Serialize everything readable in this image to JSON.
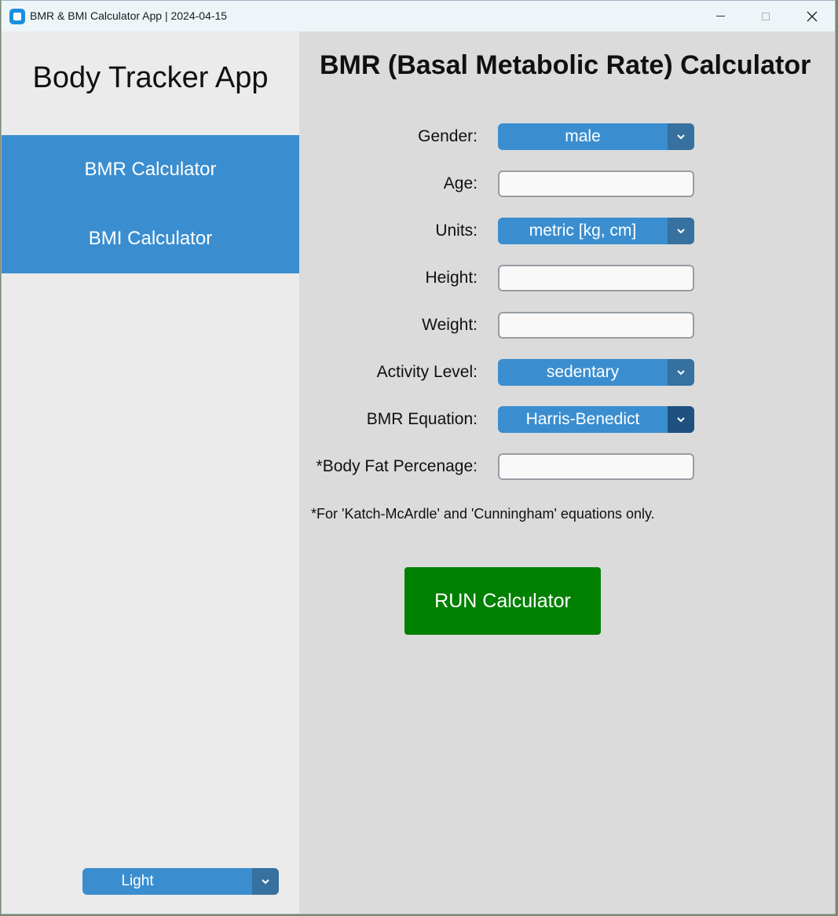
{
  "window": {
    "title": "BMR & BMI Calculator App | 2024-04-15"
  },
  "sidebar": {
    "app_title": "Body Tracker App",
    "nav_items": [
      {
        "label": "BMR Calculator"
      },
      {
        "label": "BMI Calculator"
      }
    ],
    "appearance_mode": "Light"
  },
  "main": {
    "heading": "BMR (Basal Metabolic Rate) Calculator",
    "fields": {
      "gender": {
        "label": "Gender:",
        "value": "male"
      },
      "age": {
        "label": "Age:",
        "value": ""
      },
      "units": {
        "label": "Units:",
        "value": "metric [kg, cm]"
      },
      "height": {
        "label": "Height:",
        "value": ""
      },
      "weight": {
        "label": "Weight:",
        "value": ""
      },
      "activity": {
        "label": "Activity Level:",
        "value": "sedentary"
      },
      "equation": {
        "label": "BMR Equation:",
        "value": "Harris-Benedict"
      },
      "body_fat": {
        "label": "*Body Fat Percenage:",
        "value": ""
      }
    },
    "note": "*For 'Katch-McArdle' and 'Cunningham' equations only.",
    "run_button": "RUN Calculator"
  },
  "colors": {
    "accent": "#3a8ed0",
    "accent_dark": "#36719f",
    "run_button": "#008000",
    "sidebar_bg": "#ebebeb",
    "main_bg": "#dbdbdb"
  },
  "icons": {
    "app": "app-icon",
    "minimize": "minimize-icon",
    "maximize": "maximize-icon",
    "close": "close-icon",
    "dropdown": "chevron-down-icon"
  }
}
